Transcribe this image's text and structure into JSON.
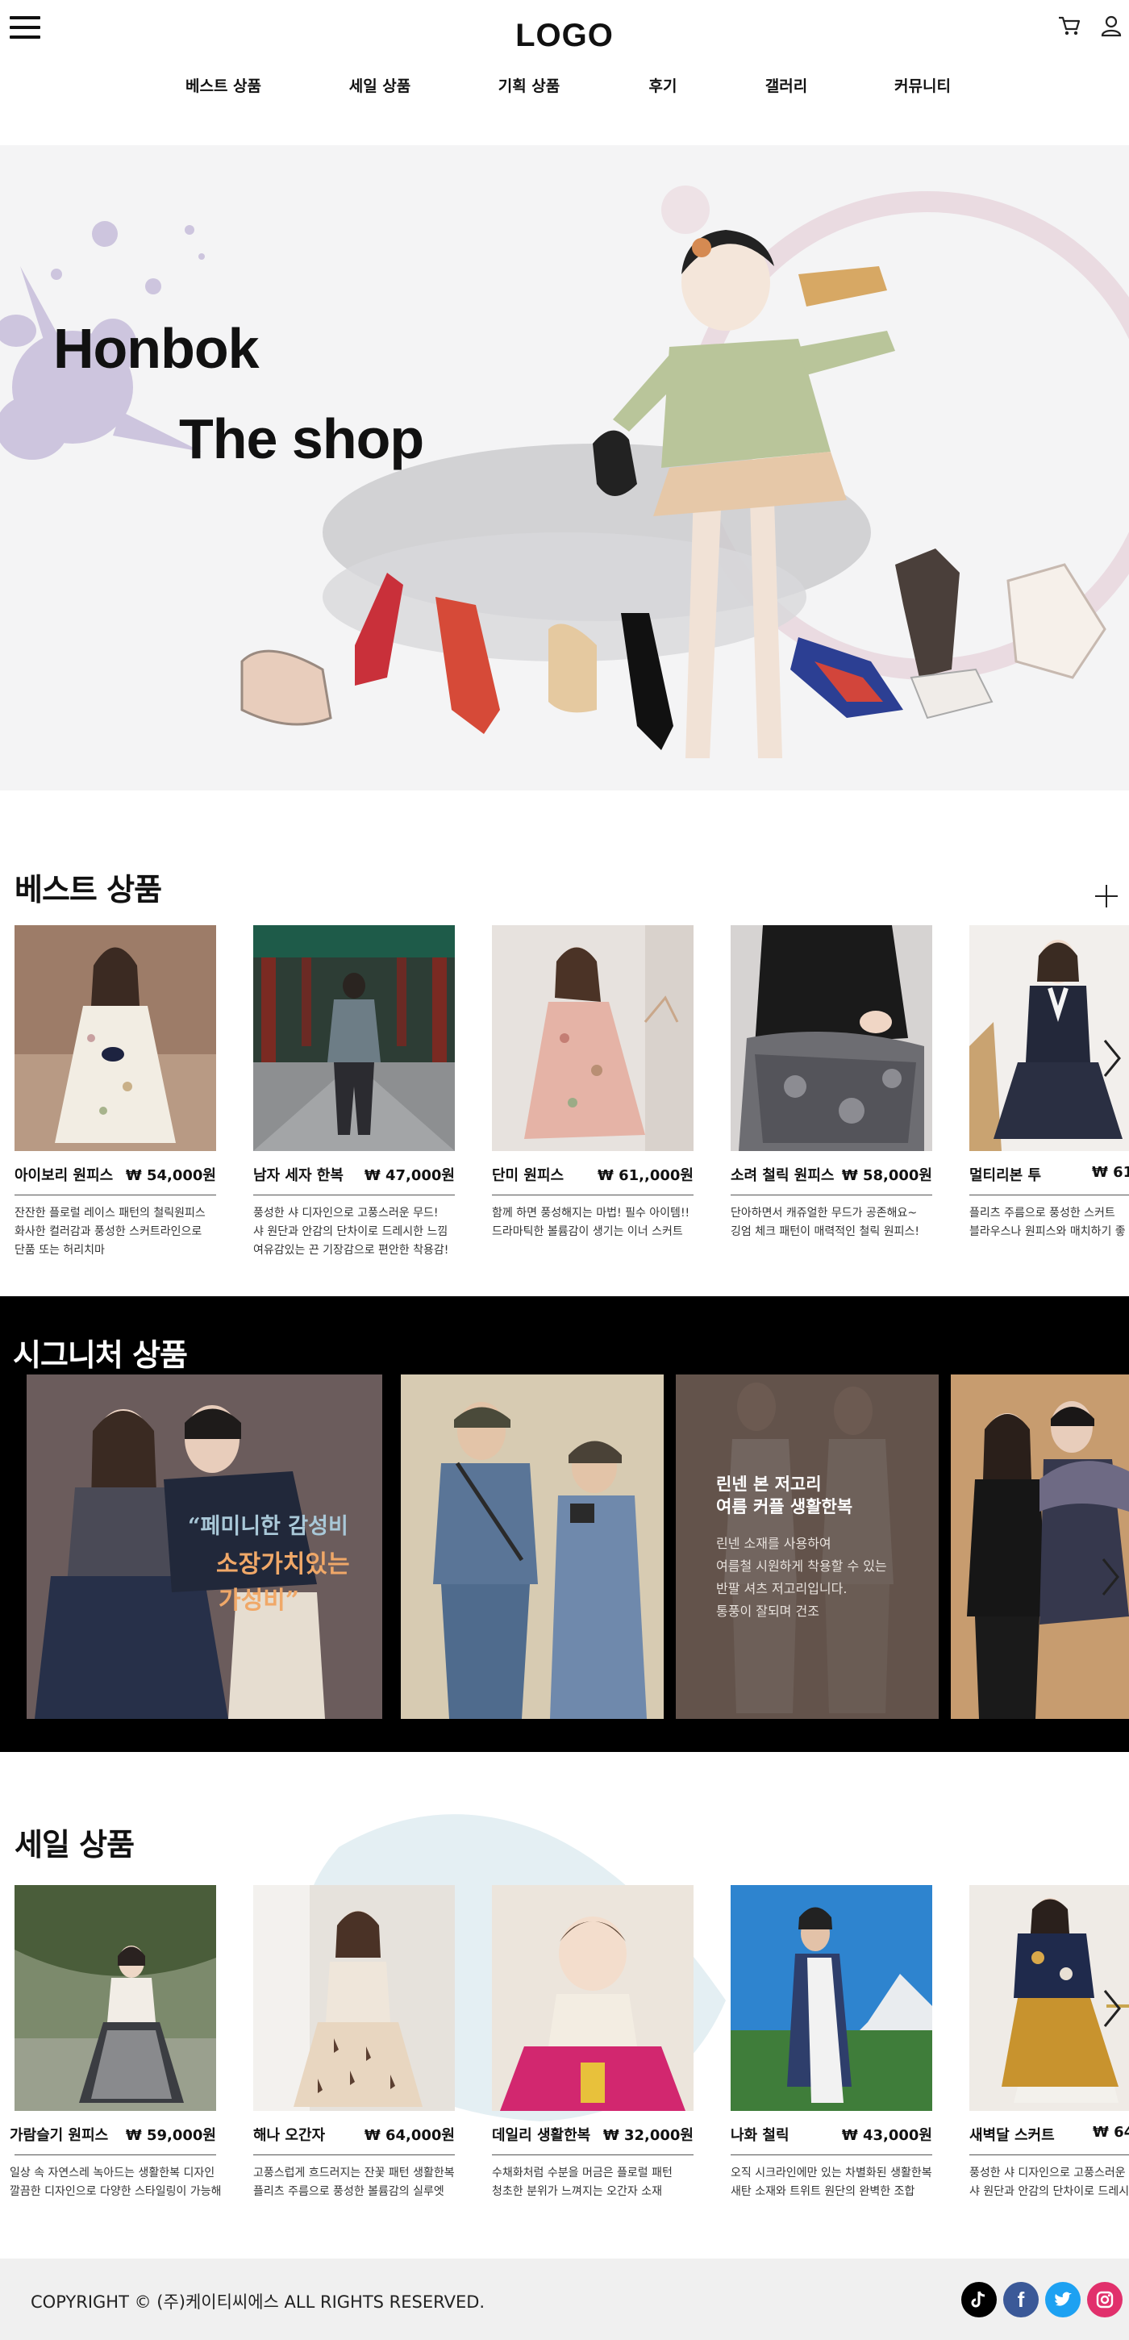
{
  "header": {
    "logo": "LOGO",
    "nav": [
      "베스트 상품",
      "세일 상품",
      "기획 상품",
      "후기",
      "갤러리",
      "커뮤니티"
    ]
  },
  "hero": {
    "line1": "Honbok",
    "line2": "The shop"
  },
  "best": {
    "title": "베스트 상품",
    "products": [
      {
        "name": "아이보리 원피스",
        "price": "₩ 54,000원",
        "desc": "잔잔한 플로럴 레이스 패턴의 철릭원피스\n화사한 컬러감과 풍성한 스커트라인으로\n단품 또는 허리치마"
      },
      {
        "name": "남자 세자 한복",
        "price": "₩ 47,000원",
        "desc": "풍성한 샤 디자인으로 고풍스러운 무드!\n샤 원단과 안감의 단차이로 드레시한 느낌\n여유감있는 끈 기장감으로 편안한 착용감!"
      },
      {
        "name": "단미 원피스",
        "price": "₩ 61,,000원",
        "desc": "함께 하면 풍성해지는 마법! 필수 아이템!!\n드라마틱한 볼륨감이 생기는 이너 스커트"
      },
      {
        "name": "소려 철릭 원피스",
        "price": "₩ 58,000원",
        "desc": "단아하면서 캐쥬얼한 무드가 공존해요~\n깅엄 체크 패턴이 매력적인 철릭 원피스!"
      },
      {
        "name": "멀티리본 투",
        "price": "₩ 61,",
        "desc": "플리츠 주름으로 풍성한 스커트\n블라우스나 원피스와 매치하기 좋"
      }
    ]
  },
  "signature": {
    "title": "시그니처 상품",
    "quote_lines": [
      "“페미니한 감성비",
      "소장가치있는",
      "가성비”"
    ],
    "panel3_title": [
      "린넨 본 저고리",
      "여름 커플 생활한복"
    ],
    "panel3_body": [
      "린넨 소재를 사용하여",
      "여름철 시원하게 착용할 수 있는",
      "반팔 셔츠 저고리입니다.",
      "통풍이 잘되며 건조"
    ]
  },
  "sale": {
    "title": "세일 상품",
    "products": [
      {
        "name": "가람슬기 원피스",
        "price": "₩ 59,000원",
        "desc": "일상 속 자연스레 녹아드는 생활한복 디자인\n깔끔한 디자인으로 다양한 스타일링이 가능해"
      },
      {
        "name": "해나 오간자",
        "price": "₩ 64,000원",
        "desc": "고풍스럽게 흐드러지는 잔꽃 패턴 생활한복\n플리츠 주름으로 풍성한 볼륨감의 실루엣"
      },
      {
        "name": "데일리 생활한복",
        "price": "₩ 32,000원",
        "desc": "수채화처럼 수분을 머금은 플로럴 패턴\n청초한 분위가 느껴지는 오간자 소재"
      },
      {
        "name": "나화 철릭",
        "price": "₩ 43,000원",
        "desc": "오직 시크라인에만 있는 차별화된 생활한복\n새탄 소재와 트위트 원단의 완벽한 조합"
      },
      {
        "name": "새벽달 스커트",
        "price": "₩ 64,",
        "desc": "풍성한 샤 디자인으로 고풍스러운\n샤 원단과 안감의 단차이로 드레시"
      }
    ]
  },
  "footer": {
    "copyright": "COPYRIGHT © (주)케이티씨에스 ALL RIGHTS RESERVED.",
    "social": [
      "tiktok-icon",
      "facebook-icon",
      "twitter-icon",
      "instagram-icon"
    ],
    "social_colors": [
      "#000000",
      "#3b5998",
      "#1da1f2",
      "#e1306c"
    ]
  }
}
